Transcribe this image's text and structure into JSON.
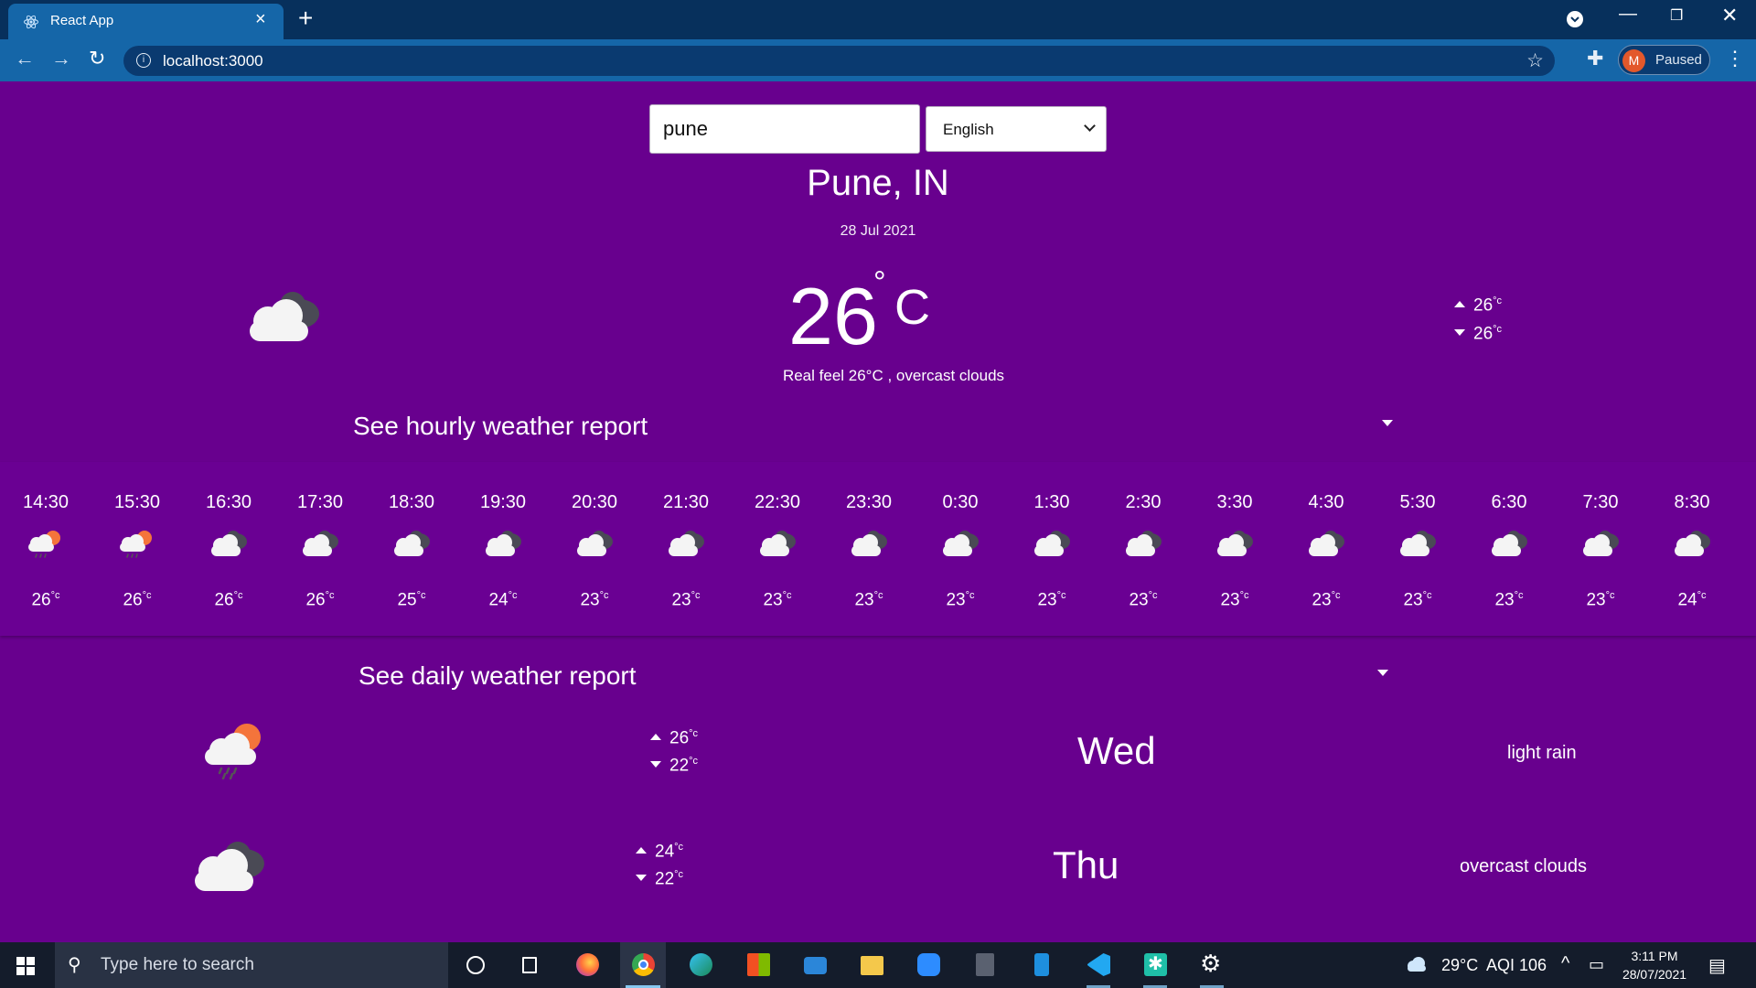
{
  "browser": {
    "tab_title": "React App",
    "url": "localhost:3000",
    "profile_initial": "M",
    "profile_status": "Paused"
  },
  "search": {
    "value": "pune"
  },
  "language": {
    "selected": "English"
  },
  "location": {
    "city": "Pune, IN",
    "date": "28 Jul 2021"
  },
  "current": {
    "temp": "26",
    "deg_symbol": "°",
    "unit": "C",
    "real_feel": "Real feel 26°C , overcast clouds",
    "max": "26",
    "min": "26",
    "unit_small": "°c",
    "icon": "cloud-icon"
  },
  "hourly": {
    "header": "See hourly weather report",
    "items": [
      {
        "time": "14:30",
        "temp": "26",
        "icon": "sun-cloud-rain-icon"
      },
      {
        "time": "15:30",
        "temp": "26",
        "icon": "sun-cloud-rain-icon"
      },
      {
        "time": "16:30",
        "temp": "26",
        "icon": "cloud-icon"
      },
      {
        "time": "17:30",
        "temp": "26",
        "icon": "cloud-icon"
      },
      {
        "time": "18:30",
        "temp": "25",
        "icon": "cloud-icon"
      },
      {
        "time": "19:30",
        "temp": "24",
        "icon": "cloud-icon"
      },
      {
        "time": "20:30",
        "temp": "23",
        "icon": "cloud-icon"
      },
      {
        "time": "21:30",
        "temp": "23",
        "icon": "cloud-icon"
      },
      {
        "time": "22:30",
        "temp": "23",
        "icon": "cloud-icon"
      },
      {
        "time": "23:30",
        "temp": "23",
        "icon": "cloud-icon"
      },
      {
        "time": "0:30",
        "temp": "23",
        "icon": "cloud-icon"
      },
      {
        "time": "1:30",
        "temp": "23",
        "icon": "cloud-icon"
      },
      {
        "time": "2:30",
        "temp": "23",
        "icon": "cloud-icon"
      },
      {
        "time": "3:30",
        "temp": "23",
        "icon": "cloud-icon"
      },
      {
        "time": "4:30",
        "temp": "23",
        "icon": "cloud-icon"
      },
      {
        "time": "5:30",
        "temp": "23",
        "icon": "cloud-icon"
      },
      {
        "time": "6:30",
        "temp": "23",
        "icon": "cloud-icon"
      },
      {
        "time": "7:30",
        "temp": "23",
        "icon": "cloud-icon"
      },
      {
        "time": "8:30",
        "temp": "24",
        "icon": "cloud-icon"
      }
    ]
  },
  "daily": {
    "header": "See daily weather report",
    "items": [
      {
        "day": "Wed",
        "max": "26",
        "min": "22",
        "description": "light rain",
        "icon": "sun-cloud-rain-icon"
      },
      {
        "day": "Thu",
        "max": "24",
        "min": "22",
        "description": "overcast clouds",
        "icon": "cloud-icon"
      }
    ]
  },
  "taskbar": {
    "search_placeholder": "Type here to search",
    "weather": "29°C",
    "aqi": "AQI 106",
    "time": "3:11 PM",
    "date": "28/07/2021"
  },
  "colors": {
    "background": "#68008e",
    "browser_titlebar": "#07305c",
    "browser_toolbar": "#1566a8",
    "taskbar": "#141c2b"
  }
}
